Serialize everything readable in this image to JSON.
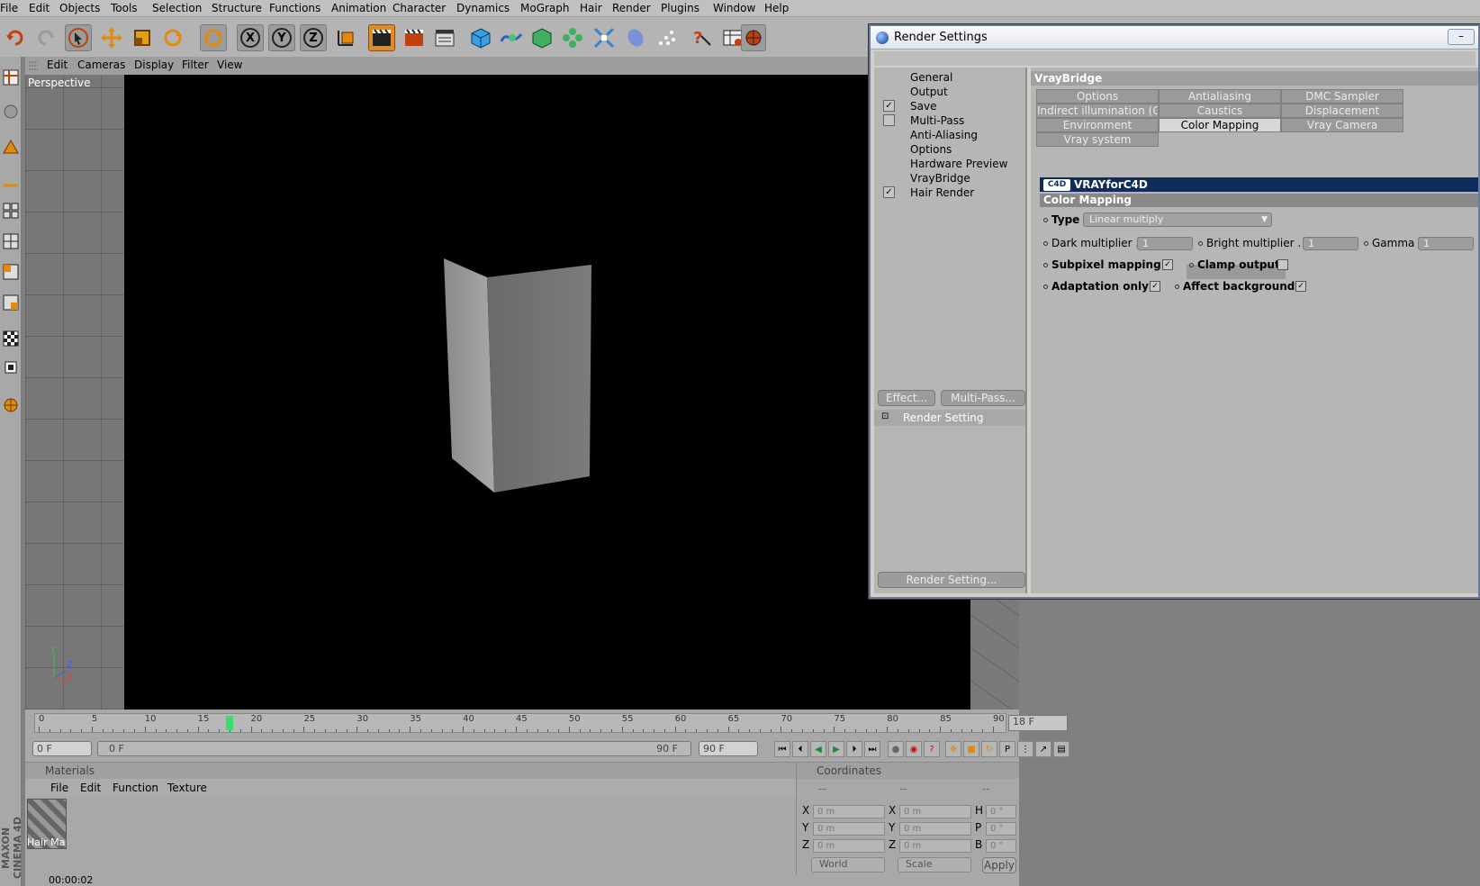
{
  "menubar": [
    "File",
    "Edit",
    "Objects",
    "Tools",
    "Selection",
    "Structure",
    "Functions",
    "Animation",
    "Character",
    "Dynamics",
    "MoGraph",
    "Hair",
    "Render",
    "Plugins",
    "Window",
    "Help"
  ],
  "toolbar": {
    "icons": [
      "undo-icon",
      "redo-icon",
      "select-icon",
      "move-icon",
      "scale-icon",
      "rotate-icon",
      "rotate-icon",
      "x-axis-icon",
      "y-axis-icon",
      "z-axis-icon",
      "coordinate-system-icon",
      "render-view-icon",
      "render-picture-icon",
      "render-settings-icon",
      "cube-icon",
      "spline-icon",
      "nurbs-icon",
      "array-icon",
      "deformer-icon",
      "scene-icon",
      "particle-icon",
      "help-icon",
      "layout-icon",
      "web-icon"
    ],
    "axis_labels": [
      "X",
      "Y",
      "Z"
    ]
  },
  "viewport": {
    "menu": [
      "Edit",
      "Cameras",
      "Display",
      "Filter",
      "View"
    ],
    "label": "Perspective",
    "axis_labels": [
      "Y",
      "Z",
      "X"
    ]
  },
  "timeline": {
    "ticks": [
      "0",
      "5",
      "10",
      "15",
      "20",
      "25",
      "30",
      "35",
      "40",
      "45",
      "50",
      "55",
      "60",
      "65",
      "70",
      "75",
      "80",
      "85",
      "90"
    ],
    "playhead_marker": "18",
    "current_frame": "18 F",
    "start_field": "0 F",
    "range_start": "0 F",
    "range_end": "90 F",
    "end_field": "90 F"
  },
  "materials": {
    "title": "Materials",
    "menu": [
      "File",
      "Edit",
      "Function",
      "Texture"
    ],
    "item_label": "Hair Ma"
  },
  "coordinates": {
    "title": "Coordinates",
    "col_headers": [
      "--",
      "--",
      "--"
    ],
    "rows": [
      {
        "a": "X",
        "av": "0 m",
        "b": "X",
        "bv": "0 m",
        "c": "H",
        "cv": "0 °"
      },
      {
        "a": "Y",
        "av": "0 m",
        "b": "Y",
        "bv": "0 m",
        "c": "P",
        "cv": "0 °"
      },
      {
        "a": "Z",
        "av": "0 m",
        "b": "Z",
        "bv": "0 m",
        "c": "B",
        "cv": "0 °"
      }
    ],
    "world": "World",
    "scale": "Scale",
    "apply": "Apply"
  },
  "status": "00:00:02",
  "brand": "MAXON CINEMA 4D",
  "render_settings": {
    "title": "Render Settings",
    "minimize": "–",
    "nav": [
      {
        "label": "General",
        "checkbox": null
      },
      {
        "label": "Output",
        "checkbox": null
      },
      {
        "label": "Save",
        "checkbox": true
      },
      {
        "label": "Multi-Pass",
        "checkbox": false
      },
      {
        "label": "Anti-Aliasing",
        "checkbox": null
      },
      {
        "label": "Options",
        "checkbox": null
      },
      {
        "label": "Hardware Preview",
        "checkbox": null
      },
      {
        "label": "VrayBridge",
        "checkbox": null
      },
      {
        "label": "Hair Render",
        "checkbox": true
      }
    ],
    "effect_button": "Effect...",
    "multipass_button": "Multi-Pass...",
    "render_setting_item": "Render Setting",
    "render_setting_button": "Render Setting...",
    "section": "VrayBridge",
    "tabs": [
      [
        "Options",
        "Antialiasing",
        "DMC Sampler"
      ],
      [
        "Indirect illumination (GI)",
        "Caustics",
        "Displacement"
      ],
      [
        "Environment",
        "Color Mapping",
        "Vray Camera"
      ],
      [
        "Vray system"
      ]
    ],
    "active_tab": "Color Mapping",
    "banner": "VRAYforC4D",
    "banner_logo": "C4D",
    "group_title": "Color Mapping",
    "type_label": "Type",
    "type_value": "Linear multiply",
    "dark_label": "Dark multiplier . .",
    "dark_value": "1",
    "bright_label": "Bright multiplier . . .",
    "bright_value": "1",
    "gamma_label": "Gamma",
    "gamma_value": "1",
    "subpixel_label": "Subpixel mapping",
    "subpixel_checked": true,
    "clamp_label": "Clamp output",
    "clamp_checked": false,
    "adaptation_label": "Adaptation only",
    "adaptation_checked": true,
    "affect_label": "Affect background",
    "affect_checked": true
  }
}
